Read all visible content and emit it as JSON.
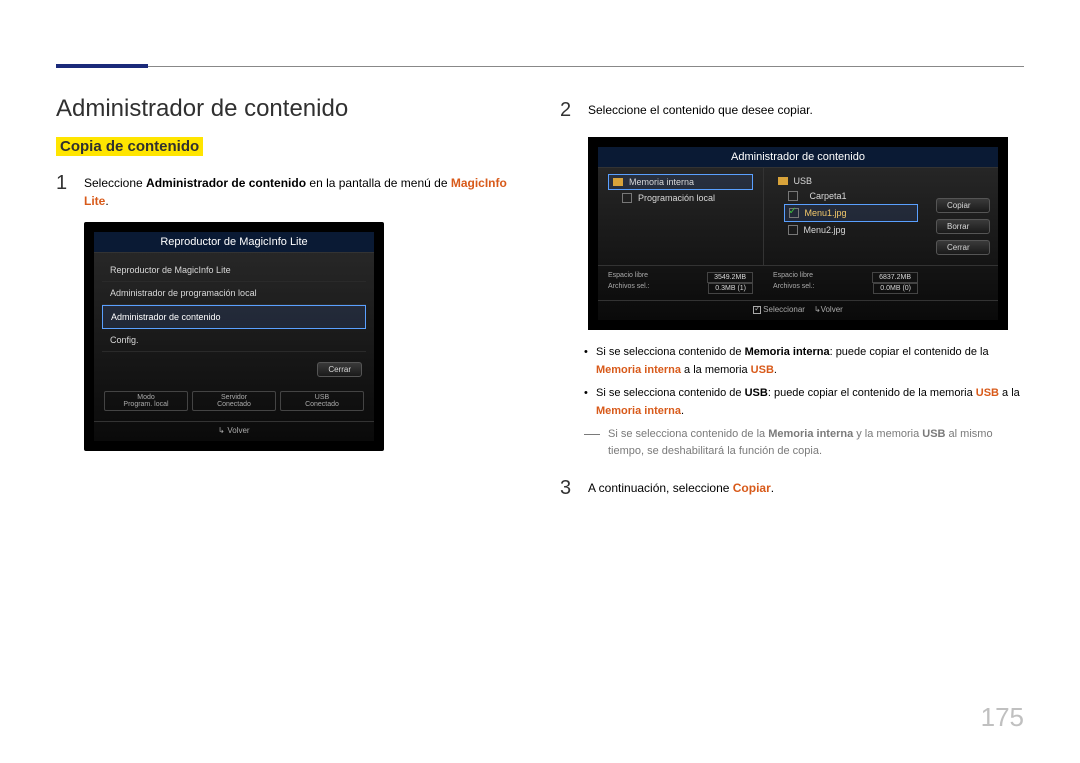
{
  "page_number": "175",
  "heading": "Administrador de contenido",
  "subheading": "Copia de contenido",
  "steps": {
    "s1": {
      "num": "1",
      "a": "Seleccione ",
      "b": "Administrador de contenido",
      "c": " en la pantalla de menú de ",
      "d": "MagicInfo Lite",
      "e": "."
    },
    "s2": {
      "num": "2",
      "text": "Seleccione el contenido que desee copiar."
    },
    "s3": {
      "num": "3",
      "a": "A continuación, seleccione ",
      "b": "Copiar",
      "c": "."
    }
  },
  "bullets": {
    "b1": {
      "a": "Si se selecciona contenido de ",
      "b": "Memoria interna",
      "c": ": puede copiar el contenido de la ",
      "d": "Memoria interna",
      "e": " a la memoria ",
      "f": "USB",
      "g": "."
    },
    "b2": {
      "a": "Si se selecciona contenido de ",
      "b": "USB",
      "c": ": puede copiar el contenido de la memoria ",
      "d": "USB",
      "e": " a la ",
      "f": "Memoria interna",
      "g": "."
    }
  },
  "note": {
    "a": "Si se selecciona contenido de la ",
    "b": "Memoria interna",
    "c": " y la memoria ",
    "d": "USB",
    "e": " al mismo tiempo, se deshabilitará la función de copia."
  },
  "shot1": {
    "title": "Reproductor de MagicInfo Lite",
    "items": [
      "Reproductor de MagicInfo Lite",
      "Administrador de programación local",
      "Administrador de contenido",
      "Config."
    ],
    "close": "Cerrar",
    "grid": [
      {
        "lbl": "Modo",
        "val": "Program. local"
      },
      {
        "lbl": "Servidor",
        "val": "Conectado"
      },
      {
        "lbl": "USB",
        "val": "Conectado"
      }
    ],
    "footer_back": "Volver"
  },
  "shot2": {
    "title": "Administrador de contenido",
    "left_tab": "Memoria interna",
    "right_tab": "USB",
    "left_item": "Programación local",
    "right_folder": "Carpeta1",
    "right_file1": "Menu1.jpg",
    "right_file2": "Menu2.jpg",
    "btn_copy": "Copiar",
    "btn_delete": "Borrar",
    "btn_close": "Cerrar",
    "stat_free": "Espacio libre",
    "stat_sel": "Archivos sel.:",
    "free_l": "3549.2MB",
    "sel_l": "0.3MB (1)",
    "free_r": "6837.2MB",
    "sel_r": "0.0MB (0)",
    "footer_select": "Seleccionar",
    "footer_back": "Volver"
  }
}
